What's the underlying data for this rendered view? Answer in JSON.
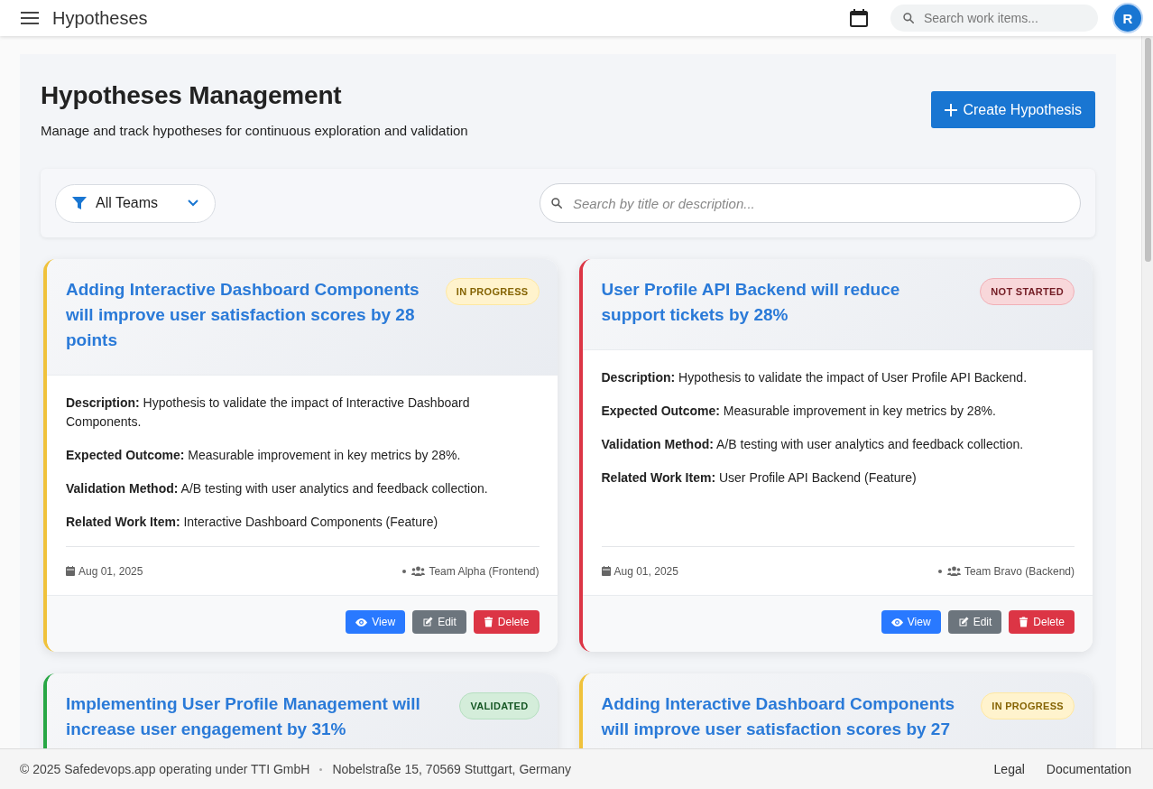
{
  "app_bar": {
    "title": "Hypotheses",
    "search": {
      "placeholder": "Search work items..."
    },
    "avatar": "R"
  },
  "page": {
    "title": "Hypotheses Management",
    "subtitle": "Manage and track hypotheses for continuous exploration and validation",
    "create_button": "Create Hypothesis"
  },
  "filters": {
    "team_filter": "All Teams",
    "search": {
      "placeholder": "Search by title or description..."
    }
  },
  "hypotheses": [
    {
      "title": "Adding Interactive Dashboard Components will improve user satisfaction scores by 28 points",
      "status": {
        "kind": "in_progress",
        "label": "IN PROGRESS"
      },
      "details": [
        "**Description:** Hypothesis to validate the impact of Interactive Dashboard Components.",
        "**Expected Outcome:** Measurable improvement in key metrics by 28%.",
        "**Validation Method:** A/B testing with user analytics and feedback collection.",
        "**Related Work Item:** Interactive Dashboard Components (Feature)"
      ],
      "date": "Aug 01, 2025",
      "team": "Team Alpha (Frontend)",
      "actions": [
        {
          "kind": "view",
          "label": "View"
        },
        {
          "kind": "edit",
          "label": "Edit"
        },
        {
          "kind": "delete",
          "label": "Delete"
        }
      ]
    },
    {
      "title": "User Profile API Backend will reduce support tickets by 28%",
      "status": {
        "kind": "not_started",
        "label": "NOT STARTED"
      },
      "details": [
        "**Description:** Hypothesis to validate the impact of User Profile API Backend.",
        "**Expected Outcome:** Measurable improvement in key metrics by 28%.",
        "**Validation Method:** A/B testing with user analytics and feedback collection.",
        "**Related Work Item:** User Profile API Backend (Feature)"
      ],
      "date": "Aug 01, 2025",
      "team": "Team Bravo (Backend)",
      "actions": [
        {
          "kind": "view",
          "label": "View"
        },
        {
          "kind": "edit",
          "label": "Edit"
        },
        {
          "kind": "delete",
          "label": "Delete"
        }
      ]
    },
    {
      "title": "Implementing User Profile Management will increase user engagement by 31%",
      "status": {
        "kind": "validated",
        "label": "VALIDATED"
      }
    },
    {
      "title": "Adding Interactive Dashboard Components will improve user satisfaction scores by 27",
      "status": {
        "kind": "in_progress",
        "label": "IN PROGRESS"
      }
    }
  ],
  "footer": {
    "copyright": "© 2025 Safedevops.app operating under TTI GmbH",
    "address": "Nobelstraße 15, 70569 Stuttgart, Germany",
    "links": [
      "Legal",
      "Documentation"
    ]
  }
}
